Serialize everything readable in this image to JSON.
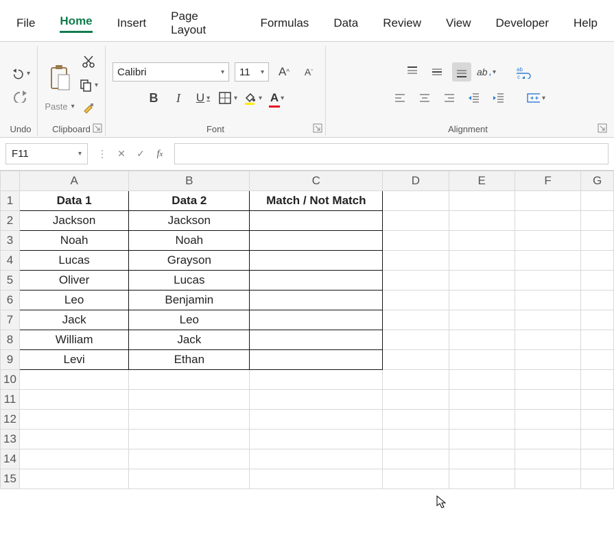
{
  "menu": {
    "file": "File",
    "home": "Home",
    "insert": "Insert",
    "page_layout": "Page Layout",
    "formulas": "Formulas",
    "data": "Data",
    "review": "Review",
    "view": "View",
    "developer": "Developer",
    "help": "Help"
  },
  "ribbon": {
    "undo": {
      "label": "Undo"
    },
    "clipboard": {
      "label": "Clipboard",
      "paste": "Paste"
    },
    "font": {
      "label": "Font",
      "name": "Calibri",
      "size": "11"
    },
    "alignment": {
      "label": "Alignment"
    }
  },
  "namebox": "F11",
  "formula": "",
  "columns": [
    "A",
    "B",
    "C",
    "D",
    "E",
    "F",
    "G"
  ],
  "rows": [
    "1",
    "2",
    "3",
    "4",
    "5",
    "6",
    "7",
    "8",
    "9",
    "10",
    "11",
    "12",
    "13",
    "14",
    "15"
  ],
  "table": {
    "headers": [
      "Data 1",
      "Data 2",
      "Match / Not Match"
    ],
    "rows": [
      [
        "Jackson",
        "Jackson",
        ""
      ],
      [
        "Noah",
        "Noah",
        ""
      ],
      [
        "Lucas",
        "Grayson",
        ""
      ],
      [
        "Oliver",
        "Lucas",
        ""
      ],
      [
        "Leo",
        "Benjamin",
        ""
      ],
      [
        "Jack",
        "Leo",
        ""
      ],
      [
        "William",
        "Jack",
        ""
      ],
      [
        "Levi",
        "Ethan",
        ""
      ]
    ]
  }
}
